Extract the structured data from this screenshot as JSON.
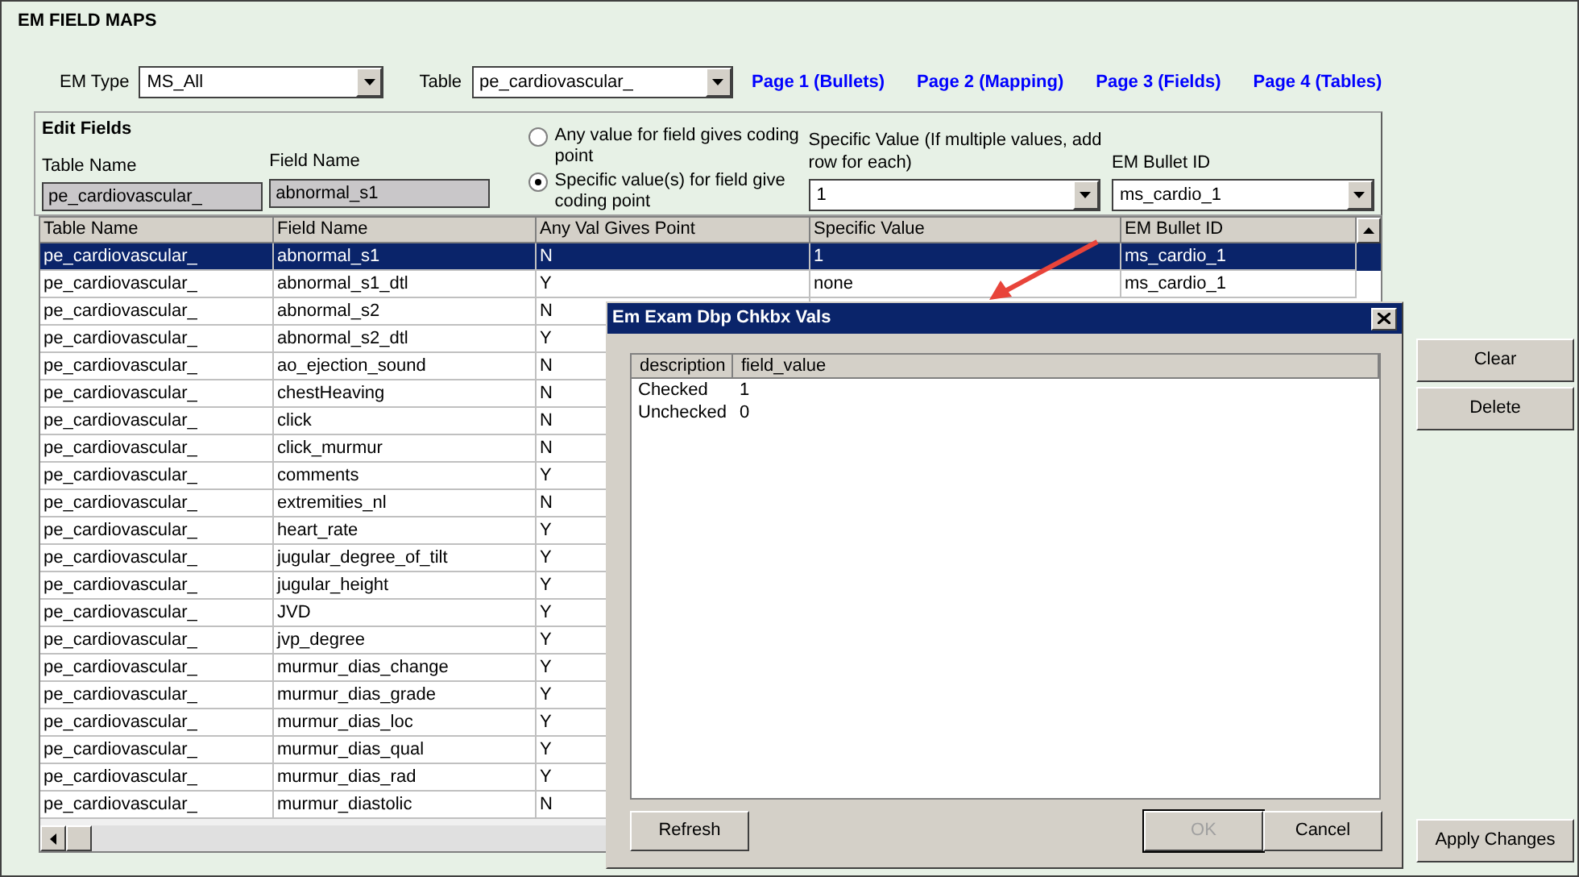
{
  "window": {
    "title": "EM FIELD MAPS"
  },
  "filters": [
    {
      "label": "EM Type",
      "value": "MS_All"
    },
    {
      "label": "Table",
      "value": "pe_cardiovascular_"
    }
  ],
  "links": [
    "Page 1 (Bullets)",
    "Page 2 (Mapping)",
    "Page 3 (Fields)",
    "Page 4 (Tables)"
  ],
  "edit_fields": {
    "title": "Edit Fields",
    "table_name": {
      "label": "Table Name",
      "value": "pe_cardiovascular_"
    },
    "field_name": {
      "label": "Field Name",
      "value": "abnormal_s1"
    },
    "coding_options": [
      {
        "label": "Any value for field gives coding point",
        "selected": false
      },
      {
        "label": "Specific value(s) for field give coding point",
        "selected": true
      }
    ],
    "specific_value": {
      "label": "Specific Value (If multiple values, add row for each)",
      "value": "1"
    },
    "em_bullet_id": {
      "label": "EM Bullet ID",
      "value": "ms_cardio_1"
    }
  },
  "table": {
    "columns": [
      "Table Name",
      "Field Name",
      "Any Val Gives Point",
      "Specific Value",
      "EM Bullet ID"
    ],
    "rows": [
      {
        "cells": [
          "pe_cardiovascular_",
          "abnormal_s1",
          "N",
          "1",
          "ms_cardio_1"
        ],
        "selected": true
      },
      {
        "cells": [
          "pe_cardiovascular_",
          "abnormal_s1_dtl",
          "Y",
          "none",
          "ms_cardio_1"
        ],
        "selected": false
      },
      {
        "cells": [
          "pe_cardiovascular_",
          "abnormal_s2",
          "N"
        ],
        "selected": false
      },
      {
        "cells": [
          "pe_cardiovascular_",
          "abnormal_s2_dtl",
          "Y"
        ],
        "selected": false
      },
      {
        "cells": [
          "pe_cardiovascular_",
          "ao_ejection_sound",
          "N"
        ],
        "selected": false
      },
      {
        "cells": [
          "pe_cardiovascular_",
          "chestHeaving",
          "N"
        ],
        "selected": false
      },
      {
        "cells": [
          "pe_cardiovascular_",
          "click",
          "N"
        ],
        "selected": false
      },
      {
        "cells": [
          "pe_cardiovascular_",
          "click_murmur",
          "N"
        ],
        "selected": false
      },
      {
        "cells": [
          "pe_cardiovascular_",
          "comments",
          "Y"
        ],
        "selected": false
      },
      {
        "cells": [
          "pe_cardiovascular_",
          "extremities_nl",
          "N"
        ],
        "selected": false
      },
      {
        "cells": [
          "pe_cardiovascular_",
          "heart_rate",
          "Y"
        ],
        "selected": false
      },
      {
        "cells": [
          "pe_cardiovascular_",
          "jugular_degree_of_tilt",
          "Y"
        ],
        "selected": false
      },
      {
        "cells": [
          "pe_cardiovascular_",
          "jugular_height",
          "Y"
        ],
        "selected": false
      },
      {
        "cells": [
          "pe_cardiovascular_",
          "JVD",
          "Y"
        ],
        "selected": false
      },
      {
        "cells": [
          "pe_cardiovascular_",
          "jvp_degree",
          "Y"
        ],
        "selected": false
      },
      {
        "cells": [
          "pe_cardiovascular_",
          "murmur_dias_change",
          "Y"
        ],
        "selected": false
      },
      {
        "cells": [
          "pe_cardiovascular_",
          "murmur_dias_grade",
          "Y"
        ],
        "selected": false
      },
      {
        "cells": [
          "pe_cardiovascular_",
          "murmur_dias_loc",
          "Y"
        ],
        "selected": false
      },
      {
        "cells": [
          "pe_cardiovascular_",
          "murmur_dias_qual",
          "Y"
        ],
        "selected": false
      },
      {
        "cells": [
          "pe_cardiovascular_",
          "murmur_dias_rad",
          "Y"
        ],
        "selected": false
      },
      {
        "cells": [
          "pe_cardiovascular_",
          "murmur_diastolic",
          "N"
        ],
        "selected": false
      }
    ]
  },
  "side_buttons": [
    "Clear",
    "Delete"
  ],
  "apply_button": "Apply Changes",
  "dialog": {
    "title": "Em Exam Dbp Chkbx Vals",
    "columns": [
      "description",
      "field_value"
    ],
    "rows": [
      [
        "Checked",
        "1"
      ],
      [
        "Unchecked",
        "0"
      ]
    ],
    "buttons": [
      {
        "label": "Refresh",
        "disabled": false
      },
      {
        "label": "OK",
        "disabled": true
      },
      {
        "label": "Cancel",
        "disabled": false
      }
    ]
  }
}
